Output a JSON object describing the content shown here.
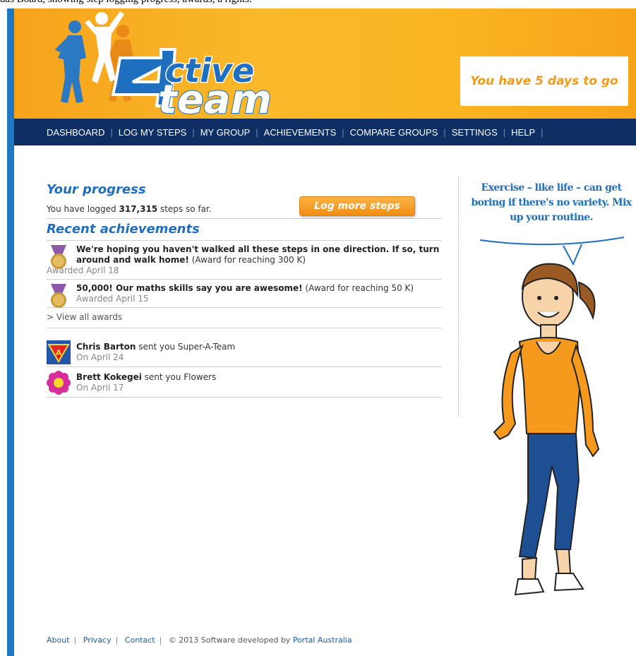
{
  "top_caption": "das Board, showing step logging progress, awards, a rights.",
  "header": {
    "logo_text": "Active 4 team",
    "countdown": "You have 5 days to go"
  },
  "nav": {
    "items": [
      "DASHBOARD",
      "LOG MY STEPS",
      "MY GROUP",
      "ACHIEVEMENTS",
      "COMPARE GROUPS",
      "SETTINGS",
      "HELP"
    ]
  },
  "progress": {
    "heading": "Your progress",
    "prefix": "You have logged ",
    "steps": "317,315",
    "suffix": " steps so far.",
    "button": "Log more steps"
  },
  "achievements": {
    "heading": "Recent achievements",
    "items": [
      {
        "title": "We're hoping you haven't walked all these steps in one direction. If so, turn around and walk home!",
        "note": " (Award for reaching 300 K)",
        "date": "Awarded April 18"
      },
      {
        "title": "50,000! Our maths skills say you are awesome!",
        "note": " (Award for reaching 50 K)",
        "date": "Awarded April 15"
      }
    ],
    "view_all": "> View all awards"
  },
  "gifts": [
    {
      "from": "Chris Barton",
      "action": " sent you Super-A-Team",
      "date": "On April 24",
      "icon": "super-a-team-icon"
    },
    {
      "from": "Brett Kokegei",
      "action": " sent you Flowers",
      "date": "On April 17",
      "icon": "flower-icon"
    }
  ],
  "sidebar": {
    "quote": "Exercise – like life – can get boring if there's no variety. Mix up your routine."
  },
  "footer": {
    "links": [
      "About",
      "Privacy",
      "Contact"
    ],
    "copyright": "© 2013 Software developed by ",
    "company": "Portal Australia"
  },
  "colors": {
    "brand_blue": "#1e6fbf",
    "nav_blue": "#0f2e63",
    "accent_orange": "#f49a17"
  }
}
